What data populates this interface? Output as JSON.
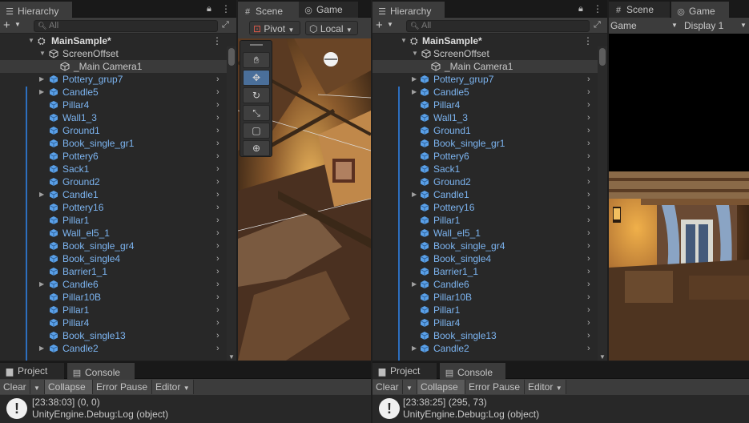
{
  "left": {
    "hierarchy_tab": "Hierarchy",
    "search_placeholder": "All",
    "scene_name": "MainSample*",
    "screen_offset": "ScreenOffset",
    "main_camera": "_Main Camera1",
    "items": [
      "Pottery_grup7",
      "Candle5",
      "Pillar4",
      "Wall1_3",
      "Ground1",
      "Book_single_gr1",
      "Pottery6",
      "Sack1",
      "Ground2",
      "Candle1",
      "Pottery16",
      "Pillar1",
      "Wall_el5_1",
      "Book_single_gr4",
      "Book_single4",
      "Barrier1_1",
      "Candle6",
      "Pillar10B",
      "Pillar1",
      "Pillar4",
      "Book_single13",
      "Candle2"
    ],
    "scene_tab": "Scene",
    "game_tab": "Game",
    "pivot_label": "Pivot",
    "local_label": "Local",
    "project_tab": "Project",
    "console_tab": "Console",
    "console_buttons": {
      "clear": "Clear",
      "collapse": "Collapse",
      "error_pause": "Error Pause",
      "editor": "Editor"
    },
    "log_line1": "[23:38:03] (0, 0)",
    "log_line2": "UnityEngine.Debug:Log (object)"
  },
  "right": {
    "hierarchy_tab": "Hierarchy",
    "search_placeholder": "All",
    "scene_name": "MainSample*",
    "screen_offset": "ScreenOffset",
    "main_camera": "_Main Camera1",
    "items": [
      "Pottery_grup7",
      "Candle5",
      "Pillar4",
      "Wall1_3",
      "Ground1",
      "Book_single_gr1",
      "Pottery6",
      "Sack1",
      "Ground2",
      "Candle1",
      "Pottery16",
      "Pillar1",
      "Wall_el5_1",
      "Book_single_gr4",
      "Book_single4",
      "Barrier1_1",
      "Candle6",
      "Pillar10B",
      "Pillar1",
      "Pillar4",
      "Book_single13",
      "Candle2"
    ],
    "scene_tab": "Scene",
    "game_tab": "Game",
    "game_dropdown": "Game",
    "display_dropdown": "Display 1",
    "project_tab": "Project",
    "console_tab": "Console",
    "console_buttons": {
      "clear": "Clear",
      "collapse": "Collapse",
      "error_pause": "Error Pause",
      "editor": "Editor"
    },
    "log_line1": "[23:38:25] (295, 73)",
    "log_line2": "UnityEngine.Debug:Log (object)"
  },
  "colors": {
    "accent_blue": "#7cb4f0",
    "selection_blue": "#2d6fbf"
  },
  "icons": [
    "hierarchy-icon",
    "lock-icon",
    "menu-icon",
    "add-icon",
    "search-icon",
    "unity-scene-icon",
    "gameobject-cube-icon",
    "hand-tool-icon",
    "move-tool-icon",
    "rotate-tool-icon",
    "scale-tool-icon",
    "rect-tool-icon",
    "transform-tool-icon",
    "gamepad-icon",
    "console-icon",
    "folder-icon",
    "warning-icon"
  ]
}
